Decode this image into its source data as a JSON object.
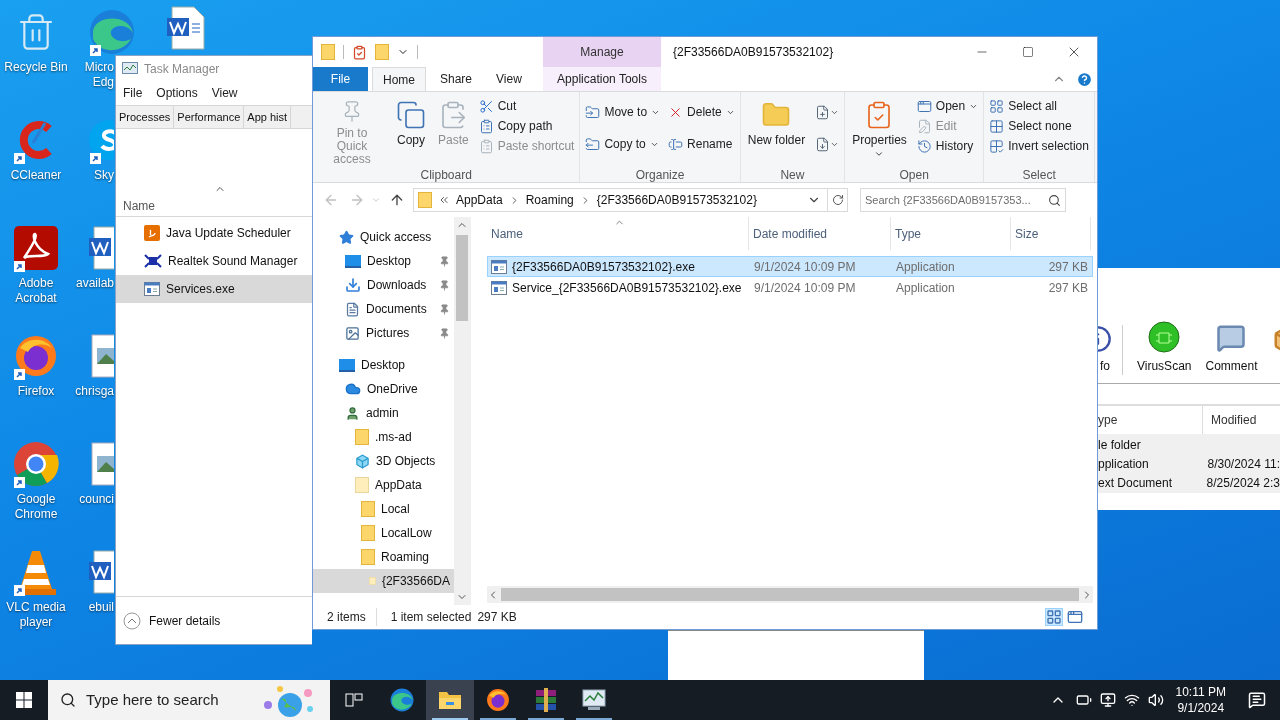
{
  "desktop": {
    "column_1": [
      {
        "kind": "bin",
        "lines": [
          "Recycle Bin"
        ],
        "shortcut": false
      },
      {
        "kind": "ccleaner",
        "lines": [
          "CCleaner"
        ],
        "shortcut": true
      },
      {
        "kind": "acrobat",
        "lines": [
          "Adobe",
          "Acrobat"
        ],
        "shortcut": true
      },
      {
        "kind": "firefox",
        "lines": [
          "Firefox"
        ],
        "shortcut": true
      },
      {
        "kind": "chrome",
        "lines": [
          "Google",
          "Chrome"
        ],
        "shortcut": true
      },
      {
        "kind": "vlc",
        "lines": [
          "VLC media",
          "player"
        ],
        "shortcut": true
      }
    ],
    "column_2": [
      {
        "kind": "edge",
        "lines": [
          "Micro",
          "Edg"
        ],
        "shortcut": true
      },
      {
        "kind": "skype",
        "lines": [
          "Sky"
        ],
        "shortcut": true
      },
      {
        "kind": "word",
        "lines": [
          "availab"
        ],
        "shortcut": false
      },
      {
        "kind": "image",
        "lines": [
          "chrisga"
        ],
        "shortcut": false
      },
      {
        "kind": "image",
        "lines": [
          "counci"
        ],
        "shortcut": false
      },
      {
        "kind": "word",
        "lines": [
          "ebuil"
        ],
        "shortcut": false
      }
    ],
    "column_3": [
      {
        "kind": "word",
        "shortcut": false
      }
    ]
  },
  "task_manager": {
    "title": "Task Manager",
    "menu": [
      "File",
      "Options",
      "View"
    ],
    "tabs": [
      {
        "label": "Processes",
        "selected": false
      },
      {
        "label": "Performance",
        "selected": false
      },
      {
        "label": "App hist",
        "selected": false
      }
    ],
    "column": "Name",
    "rows": [
      {
        "kind": "java",
        "name": "Java Update Scheduler",
        "selected": false
      },
      {
        "kind": "realtek",
        "name": "Realtek Sound Manager",
        "selected": false
      },
      {
        "kind": "app",
        "name": "Services.exe",
        "selected": true
      }
    ],
    "footer": "Fewer details"
  },
  "background_app": {
    "toolbar": [
      {
        "kind": "info",
        "label": "fo"
      },
      {
        "kind": "virus",
        "label": "VirusScan"
      },
      {
        "kind": "comment",
        "label": "Comment"
      },
      {
        "kind": "box"
      }
    ],
    "columns": [
      "ype",
      "Modified"
    ],
    "rows": [
      {
        "type": "le folder",
        "modified": ""
      },
      {
        "type": "pplication",
        "modified": "8/30/2024 11:"
      },
      {
        "type": "ext Document",
        "modified": "8/25/2024 2:3"
      }
    ]
  },
  "explorer": {
    "title": "{2F33566DA0B91573532102}",
    "context_tab": {
      "group": "Manage",
      "label": "Application Tools",
      "selected": false
    },
    "tabs": [
      {
        "label": "File",
        "kind": "file",
        "selected": false
      },
      {
        "label": "Home",
        "kind": "tab",
        "selected": true
      },
      {
        "label": "Share",
        "kind": "tab",
        "selected": false
      },
      {
        "label": "View",
        "kind": "tab",
        "selected": false
      }
    ],
    "ribbon": [
      {
        "label": "Clipboard",
        "columns": [
          [
            {
              "kind": "large",
              "label": "Pin to Quick access",
              "disabled": true,
              "dropdown": false
            }
          ],
          [
            {
              "kind": "large",
              "label": "Copy",
              "disabled": false,
              "dropdown": false
            }
          ],
          [
            {
              "kind": "large",
              "label": "Paste",
              "disabled": true,
              "dropdown": false
            }
          ],
          [
            {
              "kind": "small",
              "label": "Cut",
              "disabled": false,
              "dropdown": false
            },
            {
              "kind": "small",
              "label": "Copy path",
              "disabled": false,
              "dropdown": false
            },
            {
              "kind": "small",
              "label": "Paste shortcut",
              "disabled": true,
              "dropdown": false
            }
          ]
        ]
      },
      {
        "label": "Organize",
        "columns": [
          [
            {
              "kind": "small",
              "label": "Move to",
              "disabled": false,
              "dropdown": true
            },
            {
              "kind": "small",
              "label": "Copy to",
              "disabled": false,
              "dropdown": true
            }
          ],
          [
            {
              "kind": "small",
              "label": "Delete",
              "disabled": false,
              "dropdown": true
            },
            {
              "kind": "small",
              "label": "Rename",
              "disabled": false,
              "dropdown": false
            }
          ]
        ]
      },
      {
        "label": "New",
        "columns": [
          [
            {
              "kind": "large",
              "label": "New folder",
              "disabled": false,
              "dropdown": false
            }
          ],
          [
            {
              "kind": "icon",
              "disabled": false,
              "dropdown": true
            },
            {
              "kind": "icon",
              "disabled": false,
              "dropdown": true
            }
          ]
        ]
      },
      {
        "label": "Open",
        "columns": [
          [
            {
              "kind": "large",
              "label": "Properties",
              "disabled": false,
              "dropdown": true
            }
          ],
          [
            {
              "kind": "small",
              "label": "Open",
              "disabled": false,
              "dropdown": true
            },
            {
              "kind": "small",
              "label": "Edit",
              "disabled": true,
              "dropdown": false
            },
            {
              "kind": "small",
              "label": "History",
              "disabled": false,
              "dropdown": false
            }
          ]
        ]
      },
      {
        "label": "Select",
        "columns": [
          [
            {
              "kind": "small",
              "label": "Select all",
              "disabled": false,
              "dropdown": false
            },
            {
              "kind": "small",
              "label": "Select none",
              "disabled": false,
              "dropdown": false
            },
            {
              "kind": "small",
              "label": "Invert selection",
              "disabled": false,
              "dropdown": false
            }
          ]
        ]
      }
    ],
    "breadcrumbs": [
      "AppData",
      "Roaming",
      "{2F33566DA0B91573532102}"
    ],
    "search": {
      "placeholder": "Search {2F33566DA0B9157353..."
    },
    "nav": [
      {
        "kind": "quick",
        "label": "Quick access",
        "selected": false,
        "pinned": false,
        "children": [
          {
            "kind": "desktop",
            "label": "Desktop",
            "selected": false,
            "pinned": true
          },
          {
            "kind": "downloads",
            "label": "Downloads",
            "selected": false,
            "pinned": true
          },
          {
            "kind": "documents",
            "label": "Documents",
            "selected": false,
            "pinned": true
          },
          {
            "kind": "pictures",
            "label": "Pictures",
            "selected": false,
            "pinned": true
          }
        ]
      },
      {
        "kind": "desktop",
        "label": "Desktop",
        "selected": false,
        "pinned": false,
        "children": [
          {
            "kind": "onedrive",
            "label": "OneDrive",
            "selected": false,
            "pinned": false
          },
          {
            "kind": "user",
            "label": "admin",
            "selected": false,
            "pinned": false,
            "children": [
              {
                "kind": "folder",
                "label": ".ms-ad",
                "selected": false,
                "pinned": false
              },
              {
                "kind": "objects",
                "label": "3D Objects",
                "selected": false,
                "pinned": false
              },
              {
                "kind": "folder_light",
                "label": "AppData",
                "selected": false,
                "pinned": false,
                "children": [
                  {
                    "kind": "folder",
                    "label": "Local",
                    "selected": false,
                    "pinned": false
                  },
                  {
                    "kind": "folder",
                    "label": "LocalLow",
                    "selected": false,
                    "pinned": false
                  },
                  {
                    "kind": "folder",
                    "label": "Roaming",
                    "selected": false,
                    "pinned": false,
                    "children": [
                      {
                        "kind": "folder_light",
                        "label": "{2F33566DA",
                        "selected": true,
                        "pinned": false
                      }
                    ]
                  }
                ]
              }
            ]
          }
        ]
      }
    ],
    "columns": [
      "Name",
      "Date modified",
      "Type",
      "Size"
    ],
    "files": [
      {
        "name": "{2F33566DA0B91573532102}.exe",
        "date": "9/1/2024 10:09 PM",
        "type": "Application",
        "size": "297 KB",
        "selected": true
      },
      {
        "name": "Service_{2F33566DA0B91573532102}.exe",
        "date": "9/1/2024 10:09 PM",
        "type": "Application",
        "size": "297 KB",
        "selected": false
      }
    ],
    "status": {
      "count": "2 items",
      "selection": "1 item selected",
      "size": "297 KB"
    }
  },
  "taskbar": {
    "search": {
      "placeholder": "Type here to search"
    },
    "apps": [
      {
        "kind": "taskview",
        "running": false,
        "active": false
      },
      {
        "kind": "edge",
        "running": false,
        "active": false
      },
      {
        "kind": "explorer",
        "running": true,
        "active": true
      },
      {
        "kind": "firefox",
        "running": true,
        "active": false
      },
      {
        "kind": "winrar",
        "running": true,
        "active": false
      },
      {
        "kind": "taskmgr",
        "running": true,
        "active": false
      }
    ],
    "time": "10:11 PM",
    "date": "9/1/2024"
  }
}
